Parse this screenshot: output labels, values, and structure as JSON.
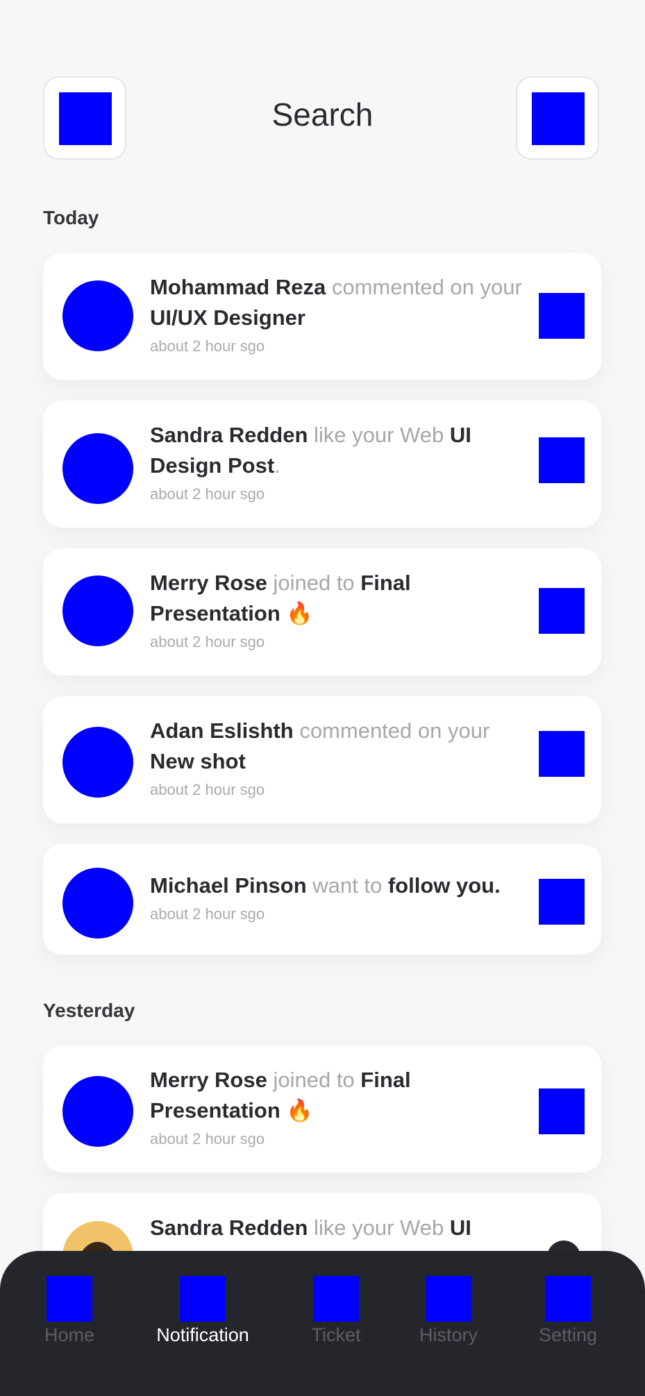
{
  "header": {
    "title": "Search",
    "left_icon": "back-icon",
    "right_icon": "menu-icon"
  },
  "sections": [
    {
      "label": "Today",
      "items": [
        {
          "name": "Mohammad Reza",
          "action": " commented on your ",
          "target": "UI/UX Designer",
          "suffix": "",
          "time": "about 2 hour sgo"
        },
        {
          "name": "Sandra Redden",
          "action": " like your Web ",
          "target": "UI Design Post",
          "suffix": ".",
          "time": "about 2 hour sgo"
        },
        {
          "name": "Merry Rose",
          "action": " joined to ",
          "target": "Final Presentation 🔥",
          "suffix": "",
          "time": "about 2 hour sgo"
        },
        {
          "name": "Adan Eslishth",
          "action": " commented on your ",
          "target": "New shot",
          "suffix": "",
          "time": "about 2 hour sgo"
        },
        {
          "name": "Michael Pinson",
          "action": " want to ",
          "target": "follow you.",
          "suffix": "",
          "time": "about 2 hour sgo"
        }
      ]
    },
    {
      "label": "Yesterday",
      "items": [
        {
          "name": "Merry Rose",
          "action": " joined to ",
          "target": "Final Presentation 🔥",
          "suffix": "",
          "time": "about 2 hour sgo"
        },
        {
          "name": "Sandra Redden",
          "action": " like your Web ",
          "target": "UI",
          "suffix": "",
          "time": ""
        }
      ]
    }
  ],
  "nav": {
    "items": [
      {
        "label": "Home",
        "icon": "home-icon"
      },
      {
        "label": "Notification",
        "icon": "bell-icon"
      },
      {
        "label": "Ticket",
        "icon": "ticket-icon"
      },
      {
        "label": "History",
        "icon": "history-icon"
      },
      {
        "label": "Setting",
        "icon": "gear-icon"
      }
    ],
    "active": "Notification"
  },
  "colors": {
    "background": "#f7f7f8",
    "nav_background": "#24262b",
    "placeholder": "#0000ff",
    "muted_text": "#a6a7ac"
  }
}
